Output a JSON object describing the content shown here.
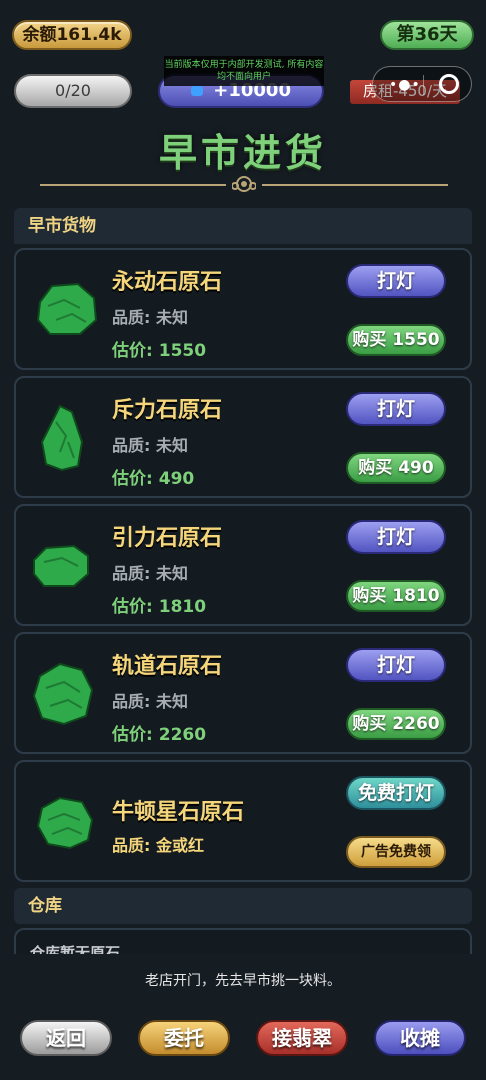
{
  "header": {
    "balance": "余额161.4k",
    "day": "第36天",
    "capacity": "0/20",
    "bonus": "+10000",
    "rent": "房租-450/天",
    "notice": "当前版本仅用于内部开发测试, 所有内容均不面向用户",
    "title": "早市进货"
  },
  "market": {
    "section_label": "早市货物",
    "quality_prefix": "品质:",
    "price_prefix": "估价:",
    "items": [
      {
        "name": "永动石原石",
        "quality": "未知",
        "price": "1550",
        "light_label": "打灯",
        "buy_label": "购买 1550"
      },
      {
        "name": "斥力石原石",
        "quality": "未知",
        "price": "490",
        "light_label": "打灯",
        "buy_label": "购买 490"
      },
      {
        "name": "引力石原石",
        "quality": "未知",
        "price": "1810",
        "light_label": "打灯",
        "buy_label": "购买 1810"
      },
      {
        "name": "轨道石原石",
        "quality": "未知",
        "price": "2260",
        "light_label": "打灯",
        "buy_label": "购买 2260"
      },
      {
        "name": "牛顿星石原石",
        "quality": "金或红",
        "light_label": "免费打灯",
        "ad_label": "广告免费领"
      }
    ]
  },
  "warehouse": {
    "section_label": "仓库",
    "partial_text": "仓库暂无原石"
  },
  "hint": "老店开门，先去早市挑一块料。",
  "bottom_nav": {
    "back": "返回",
    "commission": "委托",
    "jade": "接翡翠",
    "close_stall": "收摊"
  },
  "colors": {
    "background": "#151c22",
    "title_green": "#7fd07b",
    "name_gold": "#f5d67a",
    "price_green": "#7fd07b"
  }
}
